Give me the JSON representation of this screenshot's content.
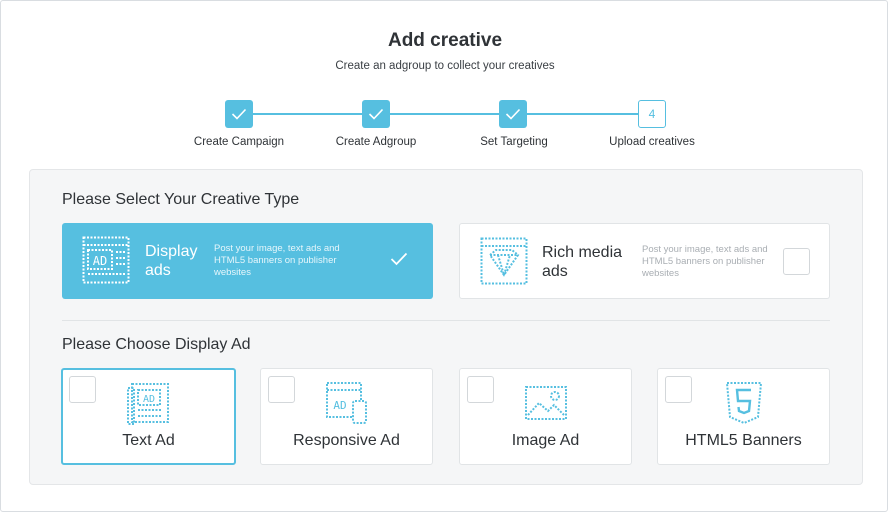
{
  "header": {
    "title": "Add creative",
    "subtitle": "Create an adgroup to collect your creatives"
  },
  "steps": [
    {
      "label": "Create Campaign",
      "state": "done"
    },
    {
      "label": "Create Adgroup",
      "state": "done"
    },
    {
      "label": "Set Targeting",
      "state": "done"
    },
    {
      "label": "Upload creatives",
      "state": "current",
      "number": "4"
    }
  ],
  "creative_type": {
    "heading": "Please Select Your Creative Type",
    "options": [
      {
        "name_line1": "Display",
        "name_line2": "ads",
        "description": "Post your image, text ads and HTML5 banners on publisher websites",
        "selected": true,
        "icon": "display-ad-icon"
      },
      {
        "name_line1": "Rich media",
        "name_line2": "ads",
        "description": "Post your image, text ads and HTML5 banners on publisher websites",
        "selected": false,
        "icon": "rich-media-icon"
      }
    ]
  },
  "display_ad": {
    "heading": "Please Choose Display Ad",
    "options": [
      {
        "label": "Text Ad",
        "selected": true,
        "icon": "text-ad-icon"
      },
      {
        "label": "Responsive Ad",
        "selected": false,
        "icon": "responsive-ad-icon"
      },
      {
        "label": "Image Ad",
        "selected": false,
        "icon": "image-ad-icon"
      },
      {
        "label": "HTML5 Banners",
        "selected": false,
        "icon": "html5-icon"
      }
    ]
  },
  "colors": {
    "accent": "#56bfe0",
    "text": "#2f3337",
    "panel_bg": "#f5f6f7"
  }
}
